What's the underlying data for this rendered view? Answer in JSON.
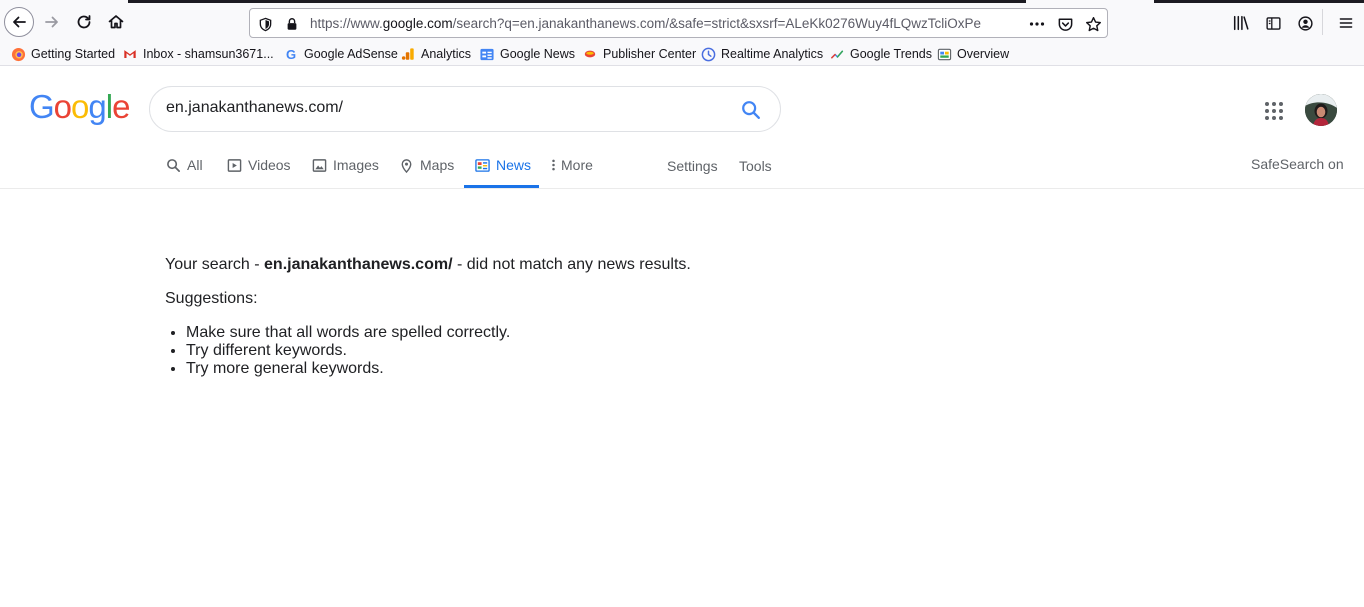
{
  "browser": {
    "url_host_prefix": "https://www.",
    "url_host": "google.com",
    "url_path": "/search?q=en.janakanthanews.com/&safe=strict&sxsrf=ALeKk0276Wuy4fLQwzTcliOxPe",
    "bookmarks": [
      {
        "label": "Getting Started",
        "icon": "firefox-icon"
      },
      {
        "label": "Inbox - shamsun3671...",
        "icon": "gmail-icon"
      },
      {
        "label": "Google AdSense",
        "icon": "google-g-icon"
      },
      {
        "label": "Analytics",
        "icon": "analytics-icon"
      },
      {
        "label": "Google News",
        "icon": "google-news-icon"
      },
      {
        "label": "Publisher Center",
        "icon": "publisher-center-icon"
      },
      {
        "label": "Realtime Analytics",
        "icon": "clock-icon"
      },
      {
        "label": "Google Trends",
        "icon": "trends-icon"
      },
      {
        "label": "Overview",
        "icon": "overview-icon"
      }
    ]
  },
  "google": {
    "logo": "Google",
    "query": "en.janakanthanews.com/",
    "tabs": [
      {
        "label": "All",
        "icon": "search-icon"
      },
      {
        "label": "Videos",
        "icon": "video-icon"
      },
      {
        "label": "Images",
        "icon": "image-icon"
      },
      {
        "label": "Maps",
        "icon": "map-pin-icon"
      },
      {
        "label": "News",
        "icon": "news-icon",
        "active": true
      },
      {
        "label": "More",
        "icon": "more-vert-icon"
      }
    ],
    "settings_label": "Settings",
    "tools_label": "Tools",
    "safesearch_label": "SafeSearch on"
  },
  "results": {
    "message_prefix": "Your search - ",
    "message_query": "en.janakanthanews.com/",
    "message_suffix": " - did not match any news results.",
    "suggestions_title": "Suggestions:",
    "suggestions": [
      "Make sure that all words are spelled correctly.",
      "Try different keywords.",
      "Try more general keywords."
    ]
  },
  "colors": {
    "accent": "#1a73e8",
    "text": "#202124",
    "muted": "#5f6368"
  }
}
